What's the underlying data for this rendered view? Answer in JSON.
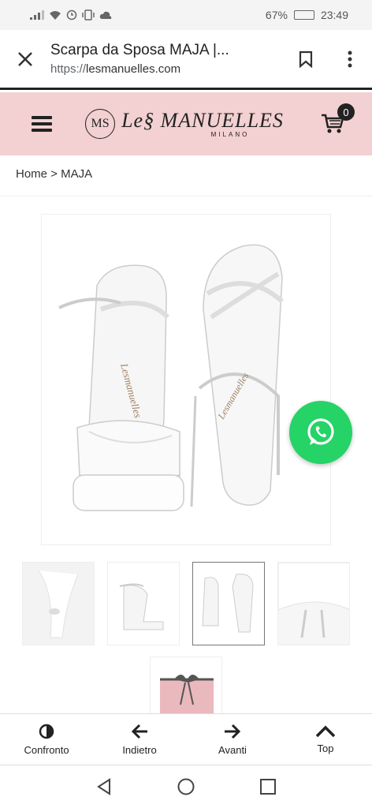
{
  "status_bar": {
    "battery": "67%",
    "time": "23:49"
  },
  "browser": {
    "title": "Scarpa da Sposa MAJA |...",
    "url_scheme": "https://",
    "url_host": "lesmanuelles.com"
  },
  "site": {
    "logo_monogram": "MS",
    "logo_name": "Le§ MANUELLES",
    "logo_city": "MILANO",
    "cart_count": "0"
  },
  "breadcrumb": "Home > MAJA",
  "colors": {
    "header_bg": "#f3d0d1",
    "whatsapp": "#25d366"
  },
  "bottom_nav": {
    "compare": "Confronto",
    "back": "Indietro",
    "forward": "Avanti",
    "top": "Top"
  }
}
